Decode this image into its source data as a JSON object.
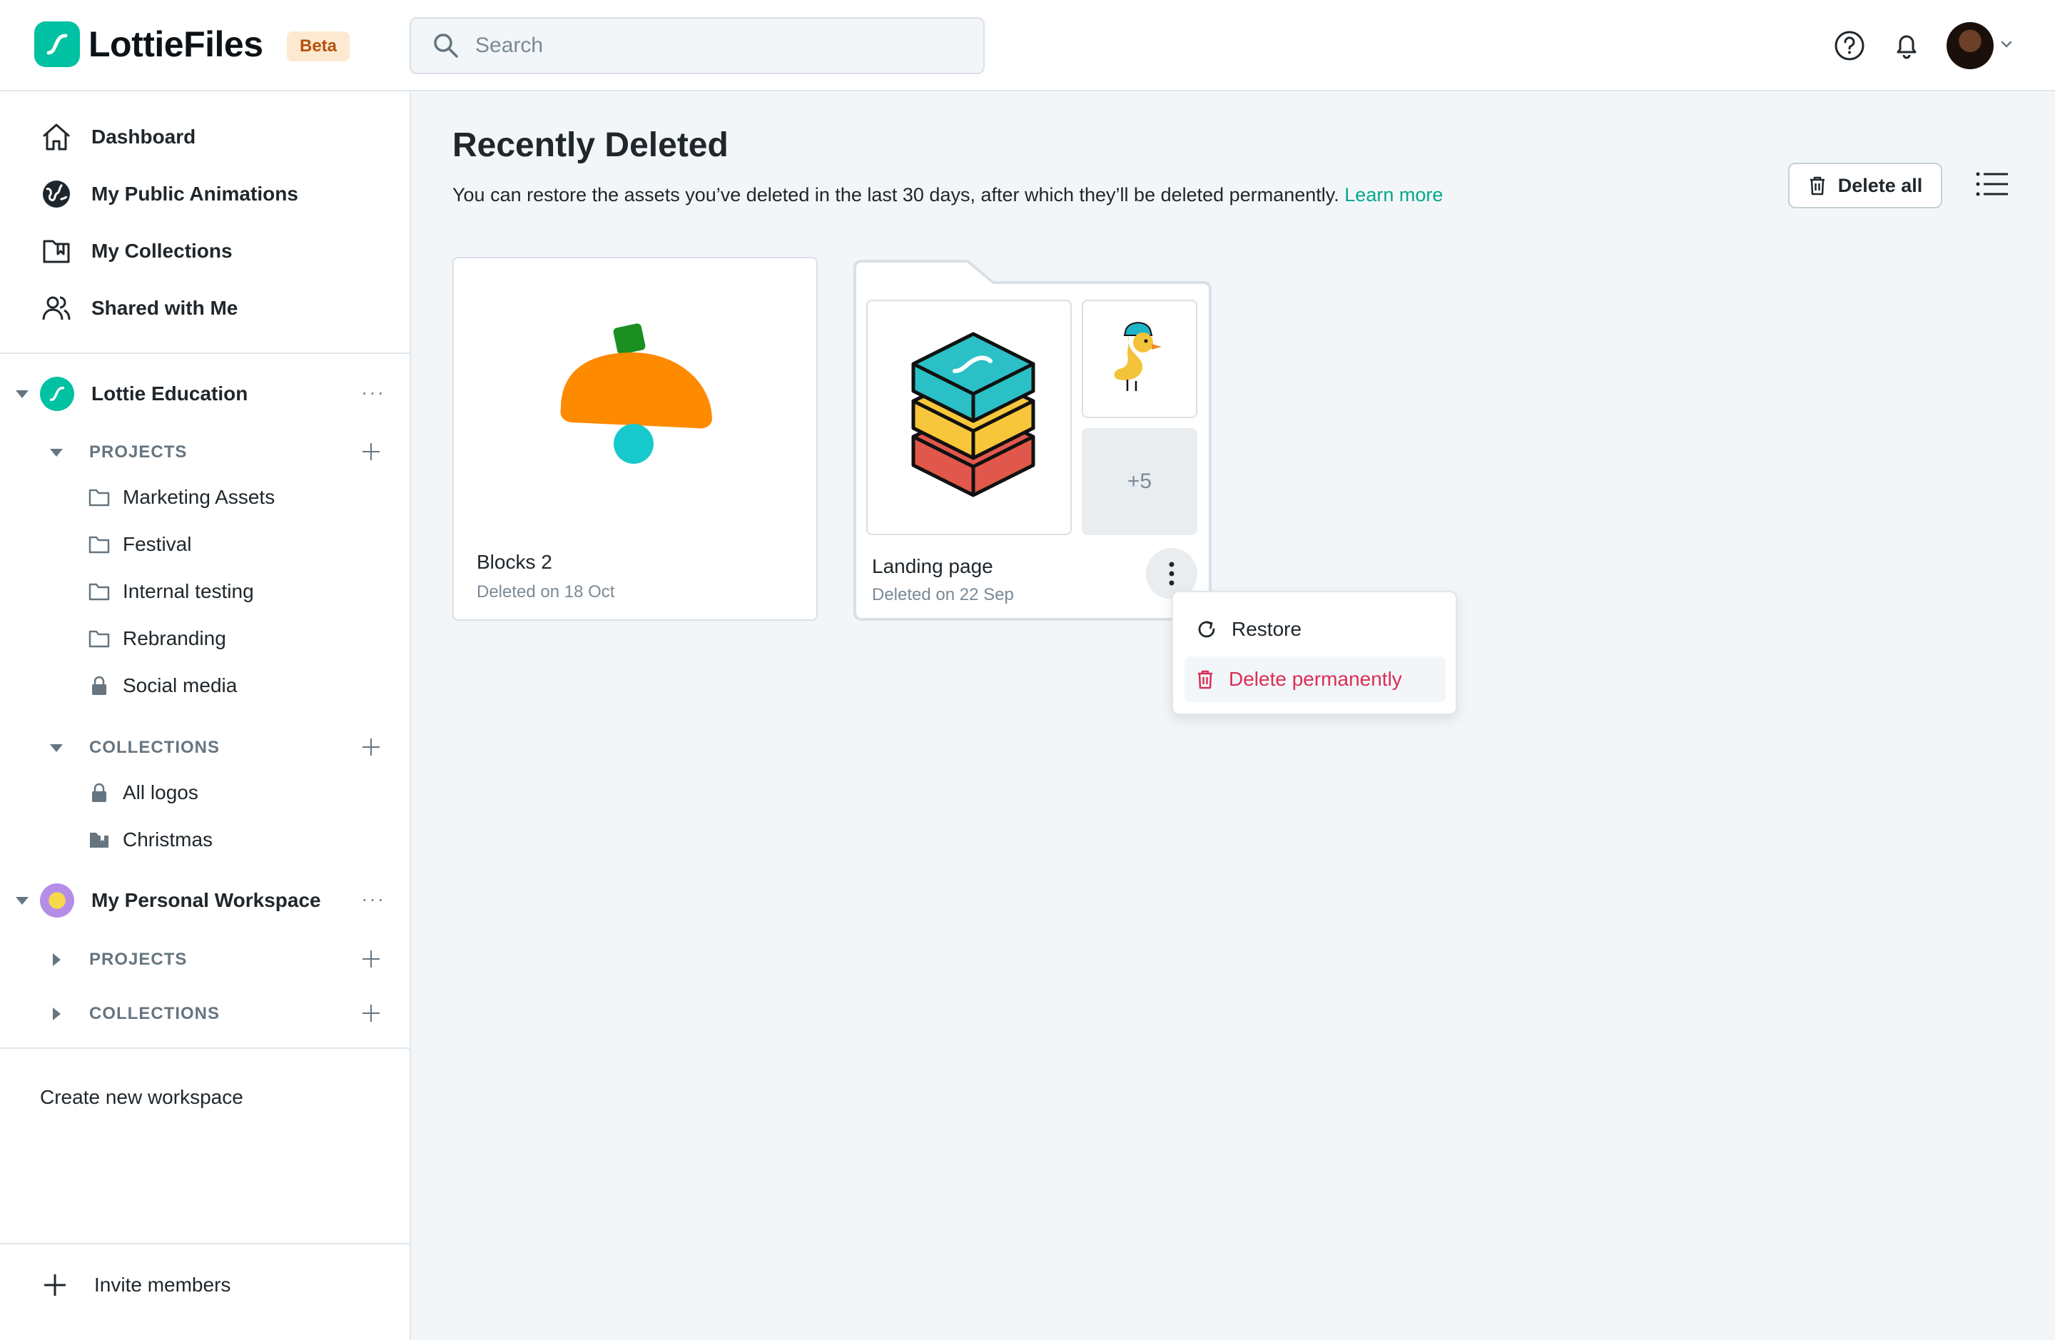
{
  "app": {
    "logo_text": "LottieFiles",
    "beta_label": "Beta",
    "brand_color": "#00c1a2"
  },
  "search": {
    "placeholder": "Search",
    "value": ""
  },
  "header_icons": [
    "help-icon",
    "bell-icon",
    "avatar",
    "chevron-down-icon"
  ],
  "sidebar": {
    "nav": [
      {
        "label": "Dashboard",
        "icon": "home-icon"
      },
      {
        "label": "My Public Animations",
        "icon": "globe-icon"
      },
      {
        "label": "My Collections",
        "icon": "collection-icon"
      },
      {
        "label": "Shared with Me",
        "icon": "users-icon"
      }
    ],
    "workspaces": [
      {
        "name": "Lottie Education",
        "projects_label": "PROJECTS",
        "projects": [
          {
            "label": "Marketing Assets",
            "icon": "folder-icon"
          },
          {
            "label": "Festival",
            "icon": "folder-icon"
          },
          {
            "label": "Internal testing",
            "icon": "folder-icon"
          },
          {
            "label": "Rebranding",
            "icon": "folder-icon"
          },
          {
            "label": "Social media",
            "icon": "lock-icon"
          }
        ],
        "collections_label": "COLLECTIONS",
        "collections": [
          {
            "label": "All logos",
            "icon": "lock-icon"
          },
          {
            "label": "Christmas",
            "icon": "collection-icon"
          }
        ]
      },
      {
        "name": "My Personal Workspace",
        "projects_label": "PROJECTS",
        "collections_label": "COLLECTIONS"
      }
    ],
    "more_label": "···",
    "create_workspace": "Create new workspace",
    "invite_members": "Invite members"
  },
  "main": {
    "title": "Recently Deleted",
    "description": "You can restore the assets you’ve deleted in the last 30 days, after which they’ll be deleted permanently.",
    "learn_more": "Learn more",
    "delete_all": "Delete all",
    "cards": [
      {
        "title": "Blocks 2",
        "subtitle": "Deleted on 18 Oct"
      },
      {
        "title": "Landing page",
        "subtitle": "Deleted on 22 Sep",
        "more_count": "+5"
      }
    ],
    "context_menu": {
      "restore": "Restore",
      "delete_permanently": "Delete permanently",
      "danger_color": "#d92e57"
    }
  }
}
